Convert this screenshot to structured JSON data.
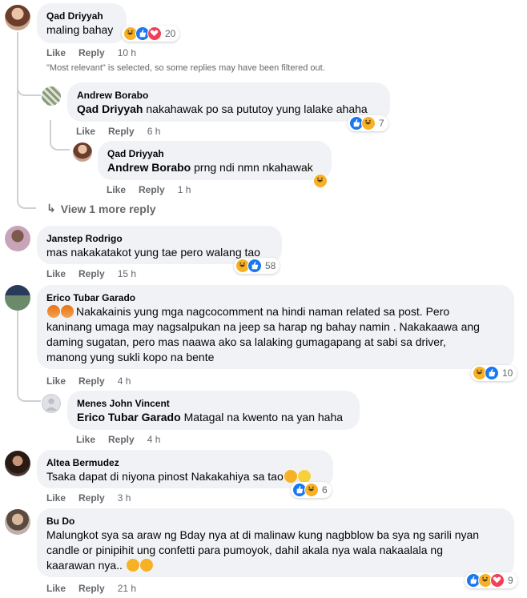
{
  "comments": [
    {
      "name": "Qad Driyyah",
      "text": "maling bahay",
      "like": "Like",
      "reply": "Reply",
      "time": "10 h",
      "reaction_count": "20",
      "reactions": [
        "haha",
        "like",
        "love"
      ]
    },
    {
      "name": "Andrew Borabo",
      "mention": "Qad Driyyah",
      "text": "nakahawak po sa pututoy yung lalake ahaha",
      "like": "Like",
      "reply": "Reply",
      "time": "6 h",
      "reaction_count": "7",
      "reactions": [
        "like",
        "haha"
      ]
    },
    {
      "name": "Qad Driyyah",
      "mention": "Andrew Borabo",
      "text": "prng ndi nmn nkahawak",
      "like": "Like",
      "reply": "Reply",
      "time": "1 h",
      "reactions": [
        "haha"
      ]
    },
    {
      "name": "Janstep Rodrigo",
      "text": "mas nakakatakot yung tae pero walang tao",
      "like": "Like",
      "reply": "Reply",
      "time": "15 h",
      "reaction_count": "58",
      "reactions": [
        "haha",
        "like"
      ]
    },
    {
      "name": "Erico Tubar Garado",
      "text_lines": [
        "Nakakainis yung mga nagcocomment na hindi naman related sa post. Pero",
        "kaninang umaga may nagsalpukan na jeep sa harap ng bahay namin . Nakakaawa ang",
        "daming sugatan, pero mas naawa ako sa lalaking gumagapang at sabi sa driver,",
        "manong yung sukli kopo na bente"
      ],
      "like": "Like",
      "reply": "Reply",
      "time": "4 h",
      "reaction_count": "10",
      "reactions": [
        "haha",
        "like"
      ]
    },
    {
      "name": "Menes John Vincent",
      "mention": "Erico Tubar Garado",
      "text": "Matagal na kwento na yan haha",
      "like": "Like",
      "reply": "Reply",
      "time": "4 h"
    },
    {
      "name": "Altea Bermudez",
      "text": "Tsaka dapat di niyona pinost Nakakahiya sa tao",
      "like": "Like",
      "reply": "Reply",
      "time": "3 h",
      "reaction_count": "6",
      "reactions": [
        "like",
        "haha"
      ]
    },
    {
      "name": "Bu Do",
      "text_lines": [
        "Malungkot sya sa araw ng Bday nya at di malinaw kung nagbblow ba sya ng sarili nyan",
        "candle or pinipihit ung confetti para pumoyok, dahil akala nya wala nakaalala ng",
        "kaarawan nya.."
      ],
      "like": "Like",
      "reply": "Reply",
      "time": "21 h",
      "reaction_count": "9",
      "reactions": [
        "like",
        "haha",
        "love"
      ]
    }
  ],
  "filtered_notice": "\"Most relevant\" is selected, so some replies may have been filtered out.",
  "view_more": "View 1 more reply",
  "colors": {
    "like": "#1877f2",
    "haha": "#f7b125",
    "love": "#f33e58",
    "bubble": "#f0f2f5",
    "meta": "#65676b"
  }
}
